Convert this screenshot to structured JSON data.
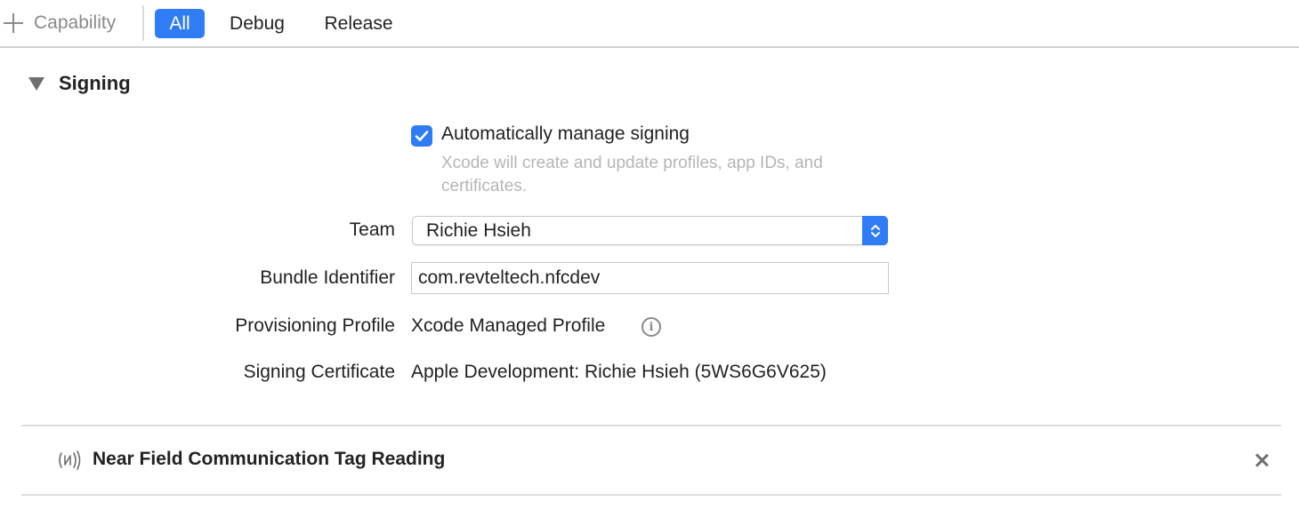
{
  "toolbar": {
    "add_capability_label": "Capability",
    "tabs": [
      {
        "label": "All",
        "active": true
      },
      {
        "label": "Debug",
        "active": false
      },
      {
        "label": "Release",
        "active": false
      }
    ]
  },
  "signing": {
    "section_title": "Signing",
    "auto_manage": {
      "label": "Automatically manage signing",
      "checked": true,
      "hint": "Xcode will create and update profiles, app IDs, and certificates."
    },
    "team": {
      "label": "Team",
      "value": "Richie Hsieh"
    },
    "bundle_identifier": {
      "label": "Bundle Identifier",
      "value": "com.revteltech.nfcdev"
    },
    "provisioning_profile": {
      "label": "Provisioning Profile",
      "value": "Xcode Managed Profile"
    },
    "signing_certificate": {
      "label": "Signing Certificate",
      "value": "Apple Development: Richie Hsieh (5WS6G6V625)"
    }
  },
  "capabilities": [
    {
      "title": "Near Field Communication Tag Reading",
      "icon": "nfc-icon"
    }
  ],
  "colors": {
    "accent": "#2f7cf6",
    "hint_text": "#b5b5b5",
    "separator": "#dcdcdc"
  }
}
